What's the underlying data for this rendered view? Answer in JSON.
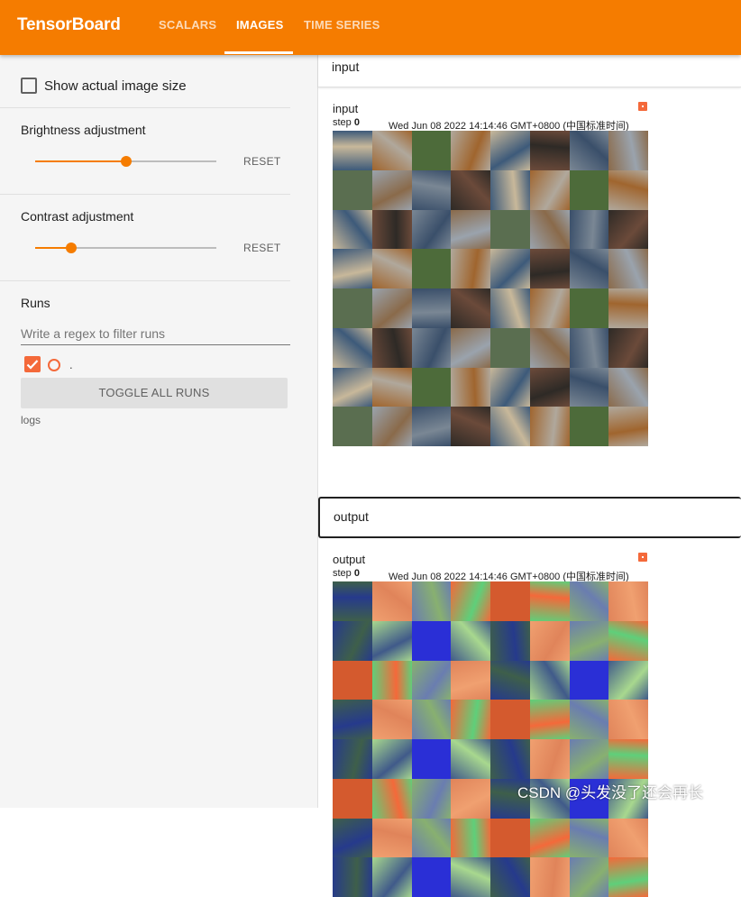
{
  "header": {
    "brand": "TensorBoard",
    "tabs": [
      {
        "label": "SCALARS"
      },
      {
        "label": "IMAGES"
      },
      {
        "label": "TIME SERIES"
      }
    ],
    "active_tab": "IMAGES",
    "accent": "#f57c00"
  },
  "sidebar": {
    "show_actual_size_label": "Show actual image size",
    "show_actual_size_checked": false,
    "brightness": {
      "label": "Brightness adjustment",
      "reset": "RESET",
      "value": 0.5
    },
    "contrast": {
      "label": "Contrast adjustment",
      "reset": "RESET",
      "value": 0.2
    },
    "runs": {
      "label": "Runs",
      "filter_placeholder": "Write a regex to filter runs",
      "run_name": ".",
      "run_checked": true,
      "run_color": "#f4693a",
      "toggle_all": "TOGGLE ALL RUNS",
      "logs_label": "logs"
    }
  },
  "main": {
    "groups": [
      {
        "header": "input",
        "card": {
          "title": "input",
          "step_label": "step",
          "step_value": "0",
          "timestamp": "Wed Jun 08 2022 14:14:46 GMT+0800 (中国标准时间)"
        }
      },
      {
        "header": "output",
        "card": {
          "title": "output",
          "step_label": "step",
          "step_value": "0",
          "timestamp": "Wed Jun 08 2022 14:14:46 GMT+0800 (中国标准时间)"
        }
      }
    ]
  },
  "watermark": "CSDN @头发没了还会再长"
}
